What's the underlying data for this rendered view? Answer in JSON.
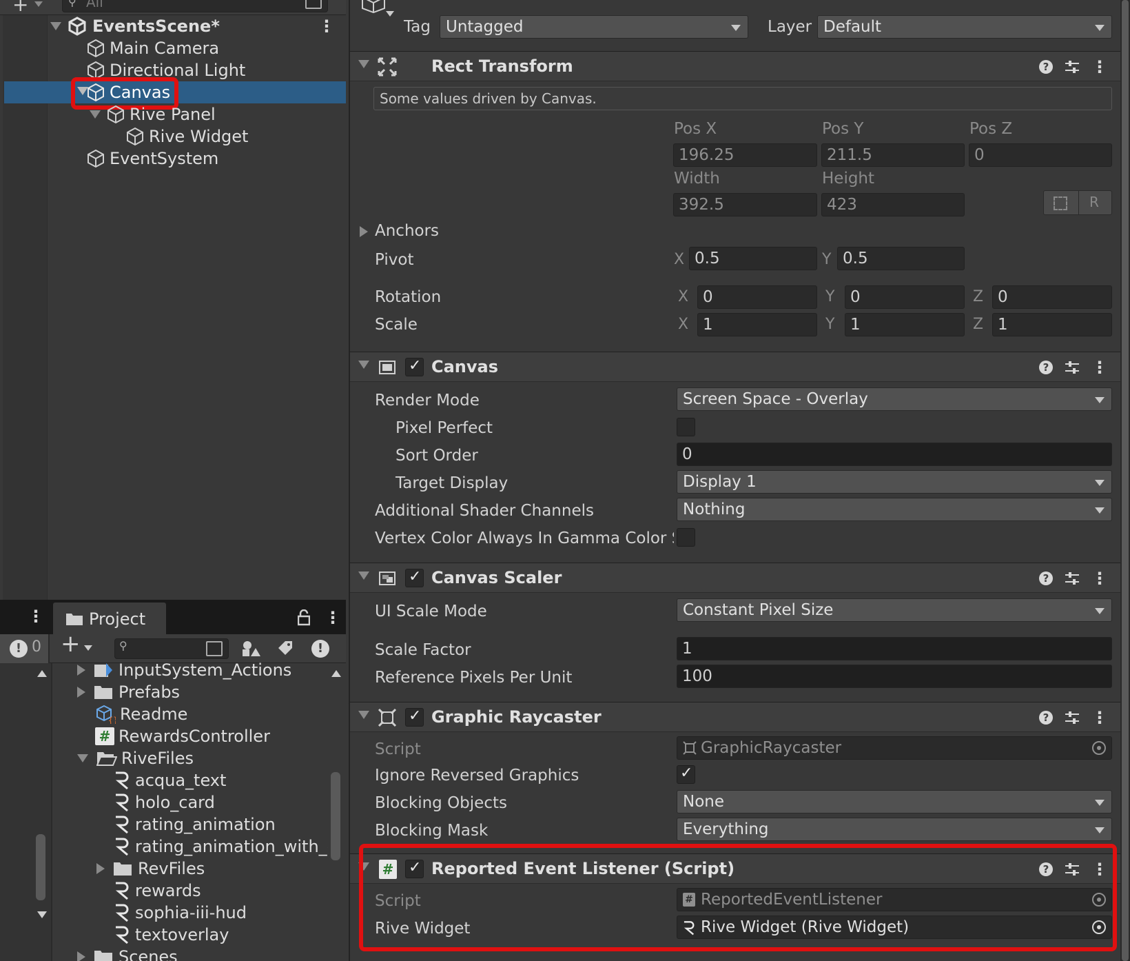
{
  "hierarchy": {
    "search_placeholder": "All",
    "scene_name": "EventsScene*",
    "items": [
      {
        "label": "Main Camera"
      },
      {
        "label": "Directional Light"
      },
      {
        "label": "Canvas"
      },
      {
        "label": "Rive Panel"
      },
      {
        "label": "Rive Widget"
      },
      {
        "label": "EventSystem"
      }
    ]
  },
  "project": {
    "tab_label": "Project",
    "console_count": "0",
    "items": [
      {
        "label": "InputSystem_Actions"
      },
      {
        "label": "Prefabs"
      },
      {
        "label": "Readme"
      },
      {
        "label": "RewardsController"
      },
      {
        "label": "RiveFiles"
      },
      {
        "label": "acqua_text"
      },
      {
        "label": "holo_card"
      },
      {
        "label": "rating_animation"
      },
      {
        "label": "rating_animation_with_e"
      },
      {
        "label": "RevFiles"
      },
      {
        "label": "rewards"
      },
      {
        "label": "sophia-iii-hud"
      },
      {
        "label": "textoverlay"
      },
      {
        "label": "Scenes"
      }
    ]
  },
  "inspector": {
    "tag_label": "Tag",
    "tag_value": "Untagged",
    "layer_label": "Layer",
    "layer_value": "Default",
    "rect_transform": {
      "title": "Rect Transform",
      "note": "Some values driven by Canvas.",
      "pos_x_label": "Pos X",
      "pos_y_label": "Pos Y",
      "pos_z_label": "Pos Z",
      "pos_x": "196.25",
      "pos_y": "211.5",
      "pos_z": "0",
      "width_label": "Width",
      "height_label": "Height",
      "width": "392.5",
      "height": "423",
      "r_button": "R",
      "anchors_label": "Anchors",
      "pivot_label": "Pivot",
      "pivot_x": "0.5",
      "pivot_y": "0.5",
      "rotation_label": "Rotation",
      "rot_x": "0",
      "rot_y": "0",
      "rot_z": "0",
      "scale_label": "Scale",
      "scale_x": "1",
      "scale_y": "1",
      "scale_z": "1",
      "axis_x": "X",
      "axis_y": "Y",
      "axis_z": "Z"
    },
    "canvas": {
      "title": "Canvas",
      "render_mode_label": "Render Mode",
      "render_mode_value": "Screen Space - Overlay",
      "pixel_perfect_label": "Pixel Perfect",
      "sort_order_label": "Sort Order",
      "sort_order_value": "0",
      "target_display_label": "Target Display",
      "target_display_value": "Display 1",
      "shader_channels_label": "Additional Shader Channels",
      "shader_channels_value": "Nothing",
      "vertex_color_label": "Vertex Color Always In Gamma Color S"
    },
    "canvas_scaler": {
      "title": "Canvas Scaler",
      "ui_scale_mode_label": "UI Scale Mode",
      "ui_scale_mode_value": "Constant Pixel Size",
      "scale_factor_label": "Scale Factor",
      "scale_factor_value": "1",
      "ref_ppu_label": "Reference Pixels Per Unit",
      "ref_ppu_value": "100"
    },
    "graphic_raycaster": {
      "title": "Graphic Raycaster",
      "script_label": "Script",
      "script_value": "GraphicRaycaster",
      "ignore_reversed_label": "Ignore Reversed Graphics",
      "blocking_objects_label": "Blocking Objects",
      "blocking_objects_value": "None",
      "blocking_mask_label": "Blocking Mask",
      "blocking_mask_value": "Everything"
    },
    "reported_event_listener": {
      "title": "Reported Event Listener (Script)",
      "script_label": "Script",
      "script_value": "ReportedEventListener",
      "rive_widget_label": "Rive Widget",
      "rive_widget_value": "Rive Widget (Rive Widget)"
    }
  },
  "colors": {
    "selection": "#2c5d87",
    "highlight_red": "#e01010",
    "panel_bg": "#383838"
  }
}
